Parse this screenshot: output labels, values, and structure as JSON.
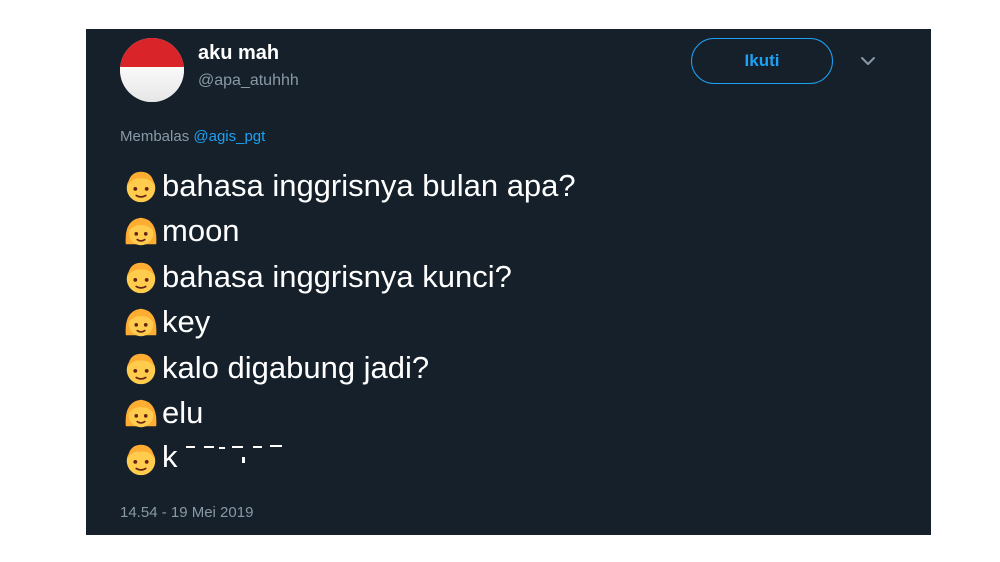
{
  "tweet": {
    "display_name": "aku mah",
    "handle": "@apa_atuhhh",
    "follow_label": "Ikuti",
    "reply_prefix": "Membalas",
    "reply_mention": "@agis_pgt",
    "lines": [
      {
        "speaker": "boy",
        "text": "bahasa inggrisnya bulan apa?"
      },
      {
        "speaker": "girl",
        "text": "moon"
      },
      {
        "speaker": "boy",
        "text": "bahasa inggrisnya kunci?"
      },
      {
        "speaker": "girl",
        "text": "key"
      },
      {
        "speaker": "boy",
        "text": "kalo digabung jadi?"
      },
      {
        "speaker": "girl",
        "text": "elu"
      },
      {
        "speaker": "boy",
        "text": "k"
      }
    ],
    "timestamp": "14.54 - 19 Mei 2019"
  },
  "colors": {
    "card_background": "#15202b",
    "accent": "#1da1f2",
    "muted_text": "#8899a6",
    "avatar_flag_red": "#d9252a"
  },
  "icons": {
    "avatar": "indonesian-flag-avatar",
    "menu": "chevron-down-icon",
    "boy": "boy-emoji-icon",
    "girl": "girl-emoji-icon"
  }
}
